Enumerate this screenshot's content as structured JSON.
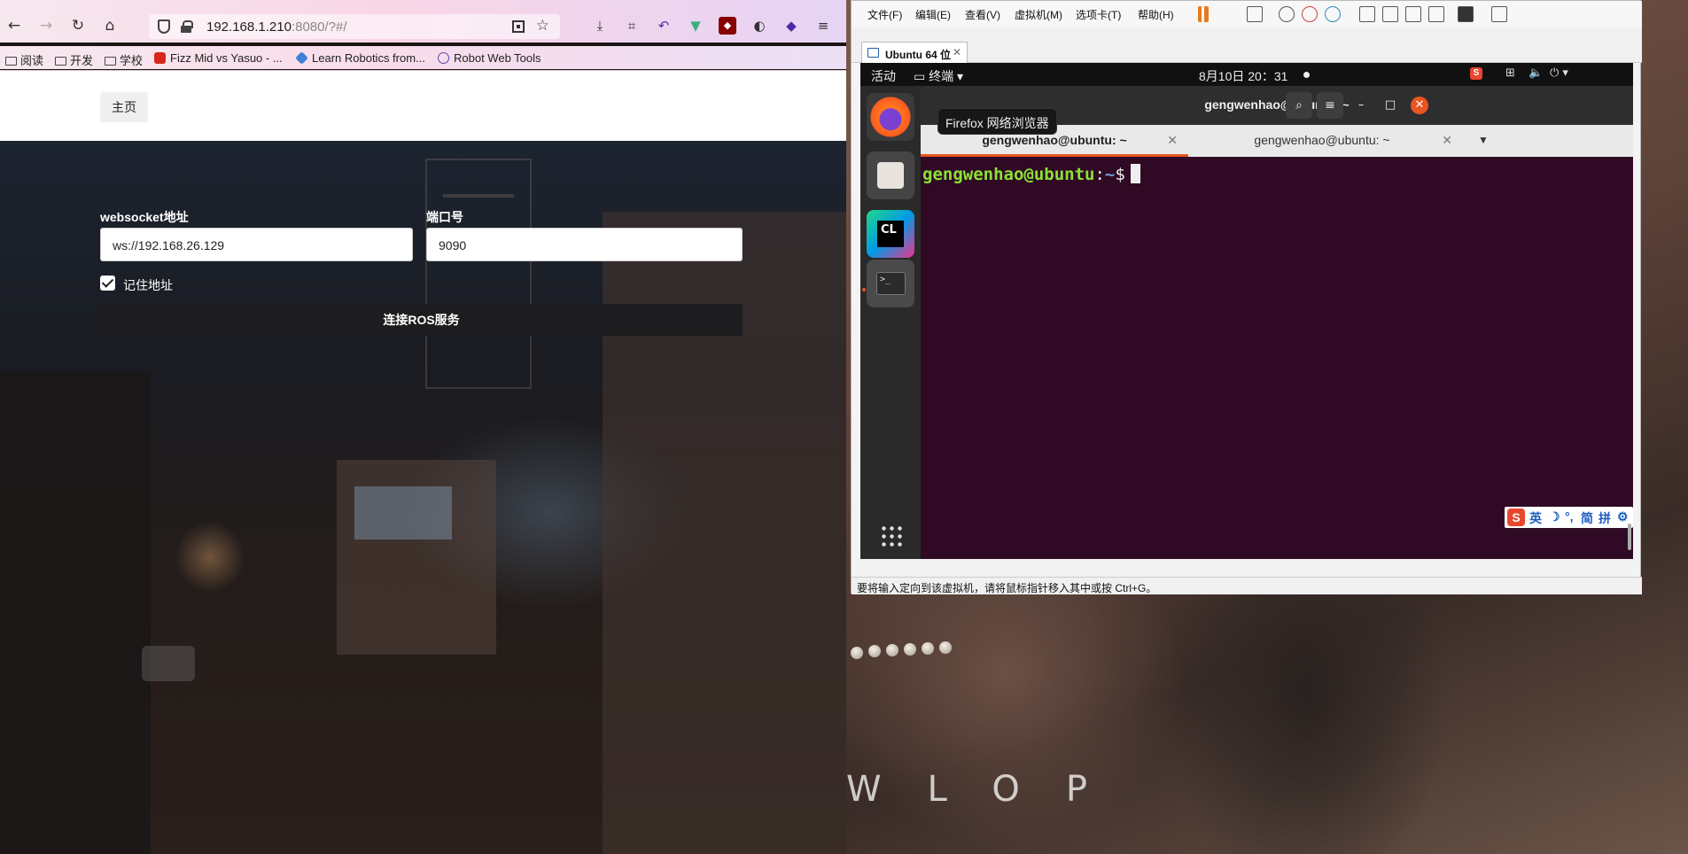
{
  "browser": {
    "url_main": "192.168.1.210",
    "url_rest": ":8080/?#/",
    "bookmarks": [
      "阅读",
      "开发",
      "学校",
      "Fizz Mid vs Yasuo - ...",
      "Learn Robotics from...",
      "Robot Web Tools"
    ]
  },
  "page": {
    "home_label": "主页",
    "ws_label": "websocket地址",
    "ws_value": "ws://192.168.26.129",
    "port_label": "端口号",
    "port_value": "9090",
    "remember_label": "记住地址",
    "remember_checked": true,
    "connect_label": "连接ROS服务"
  },
  "wallpaper": {
    "text": "WLOP"
  },
  "vmware": {
    "menu": [
      "文件(F)",
      "编辑(E)",
      "查看(V)",
      "虚拟机(M)",
      "选项卡(T)",
      "帮助(H)"
    ],
    "tab_label": "Ubuntu 64 位",
    "status_text": "要将输入定向到该虚拟机，请将鼠标指针移入其中或按 Ctrl+G。"
  },
  "ubuntu": {
    "activities": "活动",
    "app_menu": "终端",
    "clock": "8月10日  20：31",
    "tooltip": "Firefox 网络浏览器",
    "dock_clion": "CL"
  },
  "terminal": {
    "title": "gengwenhao@ubuntu: ~",
    "tabs": [
      "gengwenhao@ubuntu: ~",
      "gengwenhao@ubuntu: ~"
    ],
    "prompt_user": "gengwenhao@ubuntu",
    "prompt_sep": ":",
    "prompt_path": "~",
    "prompt_symbol": "$"
  },
  "ime": {
    "logo": "S",
    "items": [
      "英",
      "☽",
      "°,",
      "简",
      "拼",
      "⚙"
    ]
  },
  "colors": {
    "terminal_bg": "#300a24",
    "prompt_green": "#8ae234",
    "prompt_blue": "#729fcf",
    "ubuntu_orange": "#e95420"
  }
}
